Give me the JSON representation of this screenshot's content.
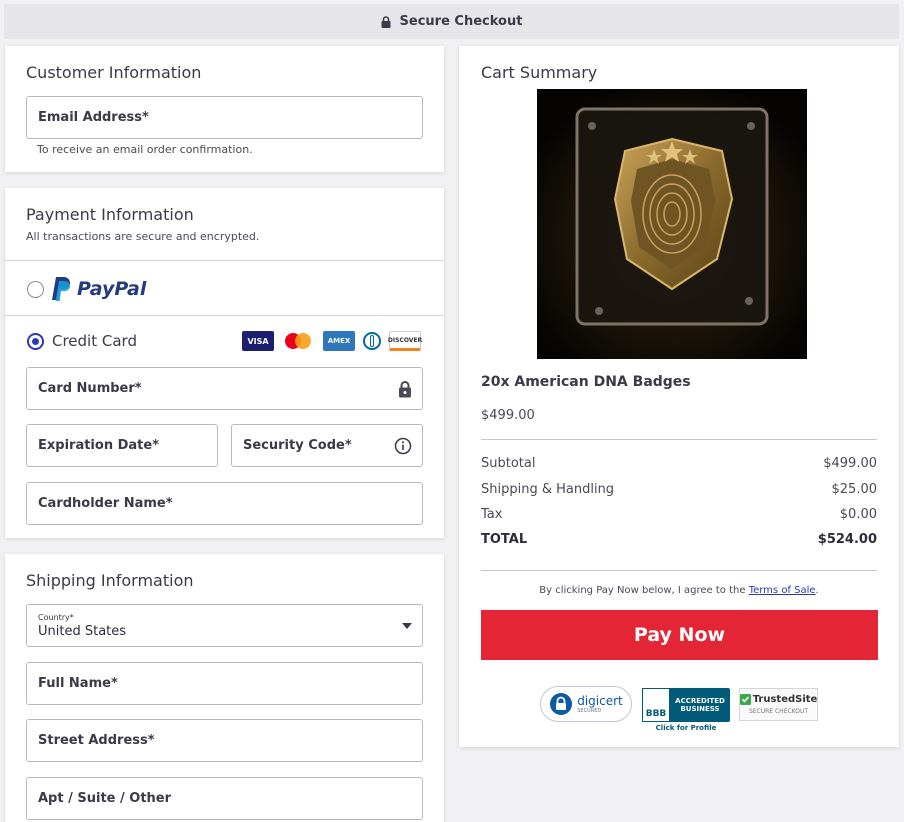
{
  "topbar": {
    "title": "Secure Checkout"
  },
  "customer": {
    "title": "Customer Information",
    "email_label": "Email Address*",
    "email_help": "To receive an email order confirmation."
  },
  "payment": {
    "title": "Payment Information",
    "subtitle": "All transactions are secure and encrypted.",
    "paypal_label": "PayPal",
    "credit_card_label": "Credit Card",
    "card_brands": [
      "VISA",
      "Mastercard",
      "AMEX",
      "Diners",
      "DISCOVER"
    ],
    "card_number_label": "Card Number*",
    "expiration_label": "Expiration Date*",
    "security_code_label": "Security Code*",
    "cardholder_label": "Cardholder Name*"
  },
  "shipping": {
    "title": "Shipping Information",
    "country_label": "Country*",
    "country_value": "United States",
    "full_name_label": "Full Name*",
    "street_label": "Street Address*",
    "apt_label": "Apt / Suite / Other"
  },
  "cart": {
    "title": "Cart Summary",
    "product_name": "20x American DNA Badges",
    "product_price": "$499.00",
    "rows": [
      {
        "label": "Subtotal",
        "value": "$499.00"
      },
      {
        "label": "Shipping & Handling",
        "value": "$25.00"
      },
      {
        "label": "Tax",
        "value": "$0.00"
      }
    ],
    "total_label": "TOTAL",
    "total_value": "$524.00",
    "terms_prefix": "By clicking Pay Now below, I agree to the ",
    "terms_link": "Terms of Sale",
    "terms_suffix": ".",
    "pay_button": "Pay Now",
    "badges": {
      "digicert": "digicert",
      "digicert_sub": "SECURED",
      "bbb_text": "ACCREDITED BUSINESS",
      "bbb_logo": "BBB",
      "bbb_click": "Click for Profile",
      "trusted": "TrustedSite",
      "trusted_sub": "SECURE CHECKOUT"
    }
  },
  "colors": {
    "accent": "#2b3ab2",
    "pay_button": "#e42535",
    "paypal_dark": "#253b80",
    "paypal_light": "#179bd7"
  }
}
